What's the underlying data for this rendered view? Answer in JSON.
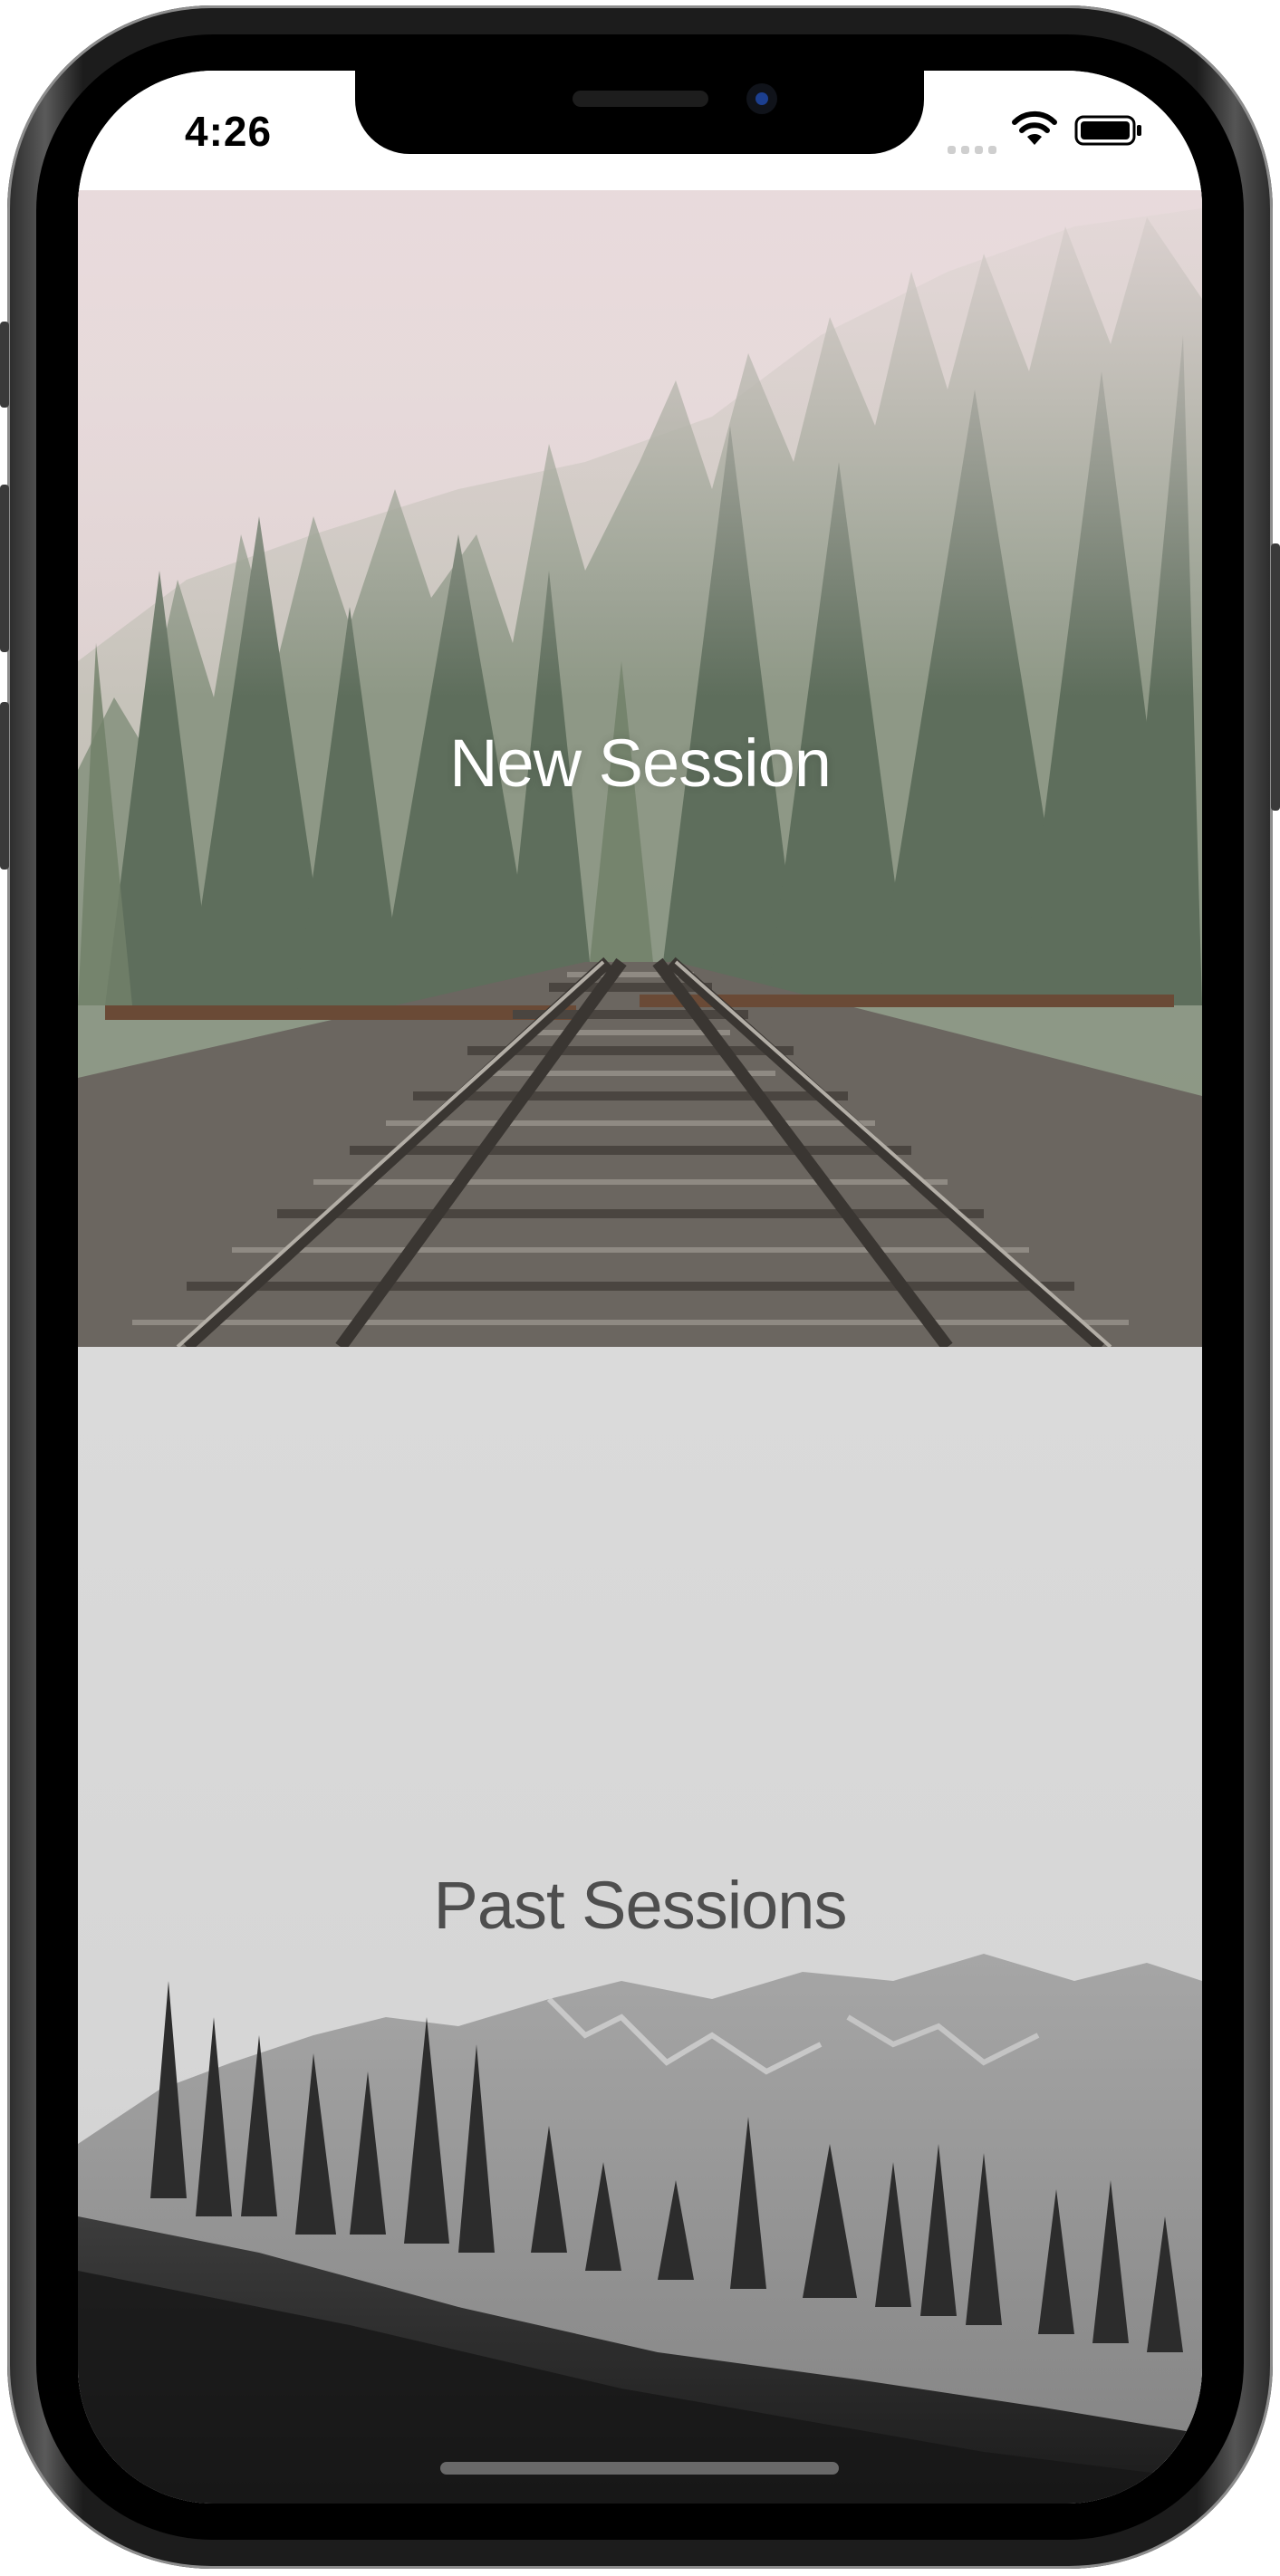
{
  "status_bar": {
    "time": "4:26",
    "icons": [
      "signal-icon",
      "wifi-icon",
      "battery-icon"
    ]
  },
  "menu": {
    "new_session_label": "New Session",
    "past_sessions_label": "Past Sessions"
  },
  "colors": {
    "new_session_text": "#ffffff",
    "past_sessions_text": "#4e4e4e"
  }
}
